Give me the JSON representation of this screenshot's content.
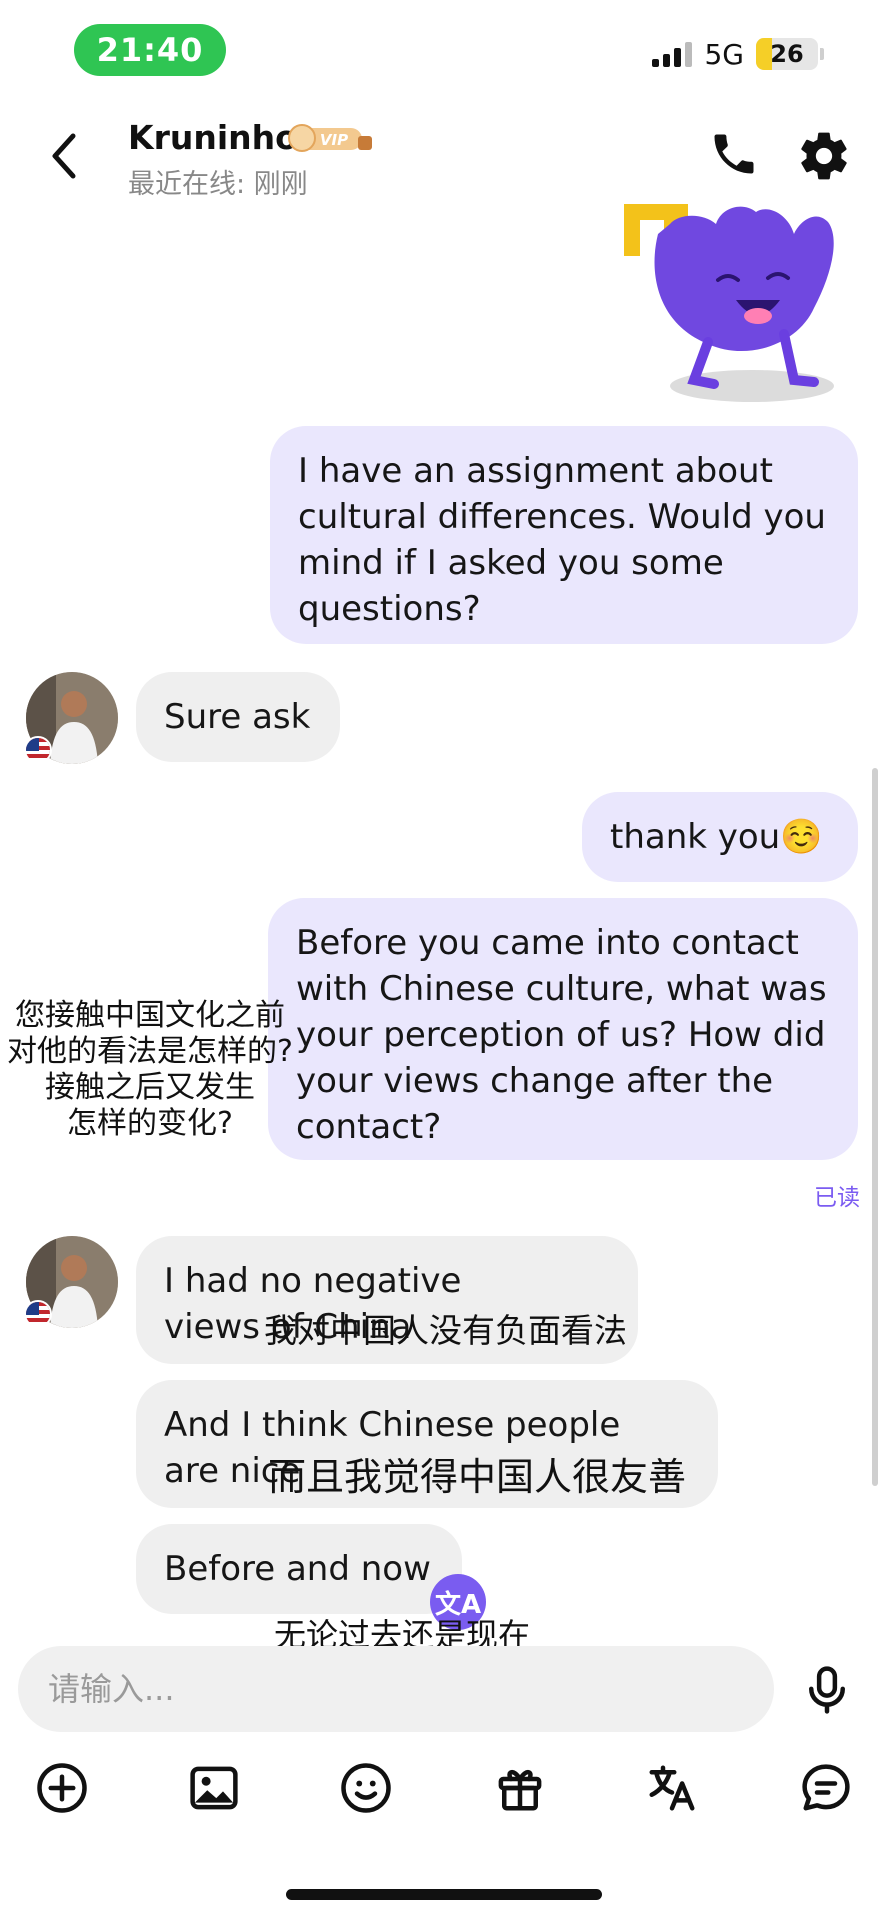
{
  "status_bar": {
    "time": "21:40",
    "network": "5G",
    "battery": "26",
    "battery_level": 0.26,
    "signal_bars": 4
  },
  "header": {
    "name": "Kruninho",
    "vip_label": "VIP",
    "last_seen": "最近在线: 刚刚"
  },
  "messages": [
    {
      "side": "me",
      "text": "I have an assignment about cultural differences. Would you mind if I asked you some questions?"
    },
    {
      "side": "them",
      "text": "Sure ask",
      "flag": "US"
    },
    {
      "side": "me",
      "text": "thank you",
      "emoji": "☺️"
    },
    {
      "side": "me",
      "text": "Before you came into contact with Chinese culture, what was your perception of us? How did your views change after the contact?"
    },
    {
      "side": "them",
      "text": "I had no negative views of China",
      "flag": "US"
    },
    {
      "side": "them",
      "text": "And I think Chinese people are nice"
    },
    {
      "side": "them",
      "text": "Before and now"
    }
  ],
  "read_receipt": "已读",
  "overlays": {
    "q_line1": "您接触中国文化之前",
    "q_line2": "对他的看法是怎样的?",
    "q_line3": "接触之后又发生",
    "q_line4": "怎样的变化?",
    "a1": "我对中国人没有负面看法",
    "a2": "而且我觉得中国人很友善",
    "a3": "无论过去还是现在"
  },
  "translate_fab": "文A",
  "composer": {
    "placeholder": "请输入..."
  },
  "toolbar": [
    "plus-icon",
    "image-icon",
    "emoji-icon",
    "gift-icon",
    "translate-icon",
    "quick-reply-icon"
  ],
  "colors": {
    "accent": "#7b5cf1",
    "my_bubble": "#eae7fd",
    "their_bubble": "#efefef",
    "time_pill": "#2fc553"
  }
}
